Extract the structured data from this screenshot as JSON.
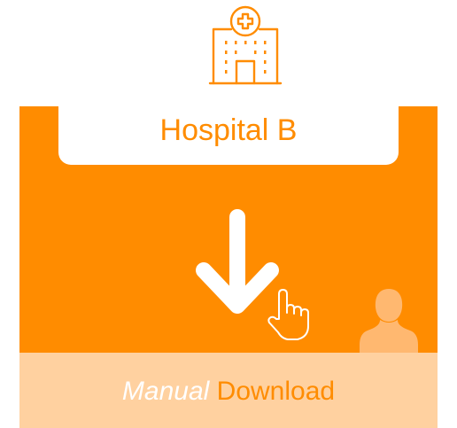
{
  "title": "Hospital B",
  "bottom": {
    "manual": "Manual",
    "download": "Download"
  },
  "colors": {
    "accent": "#FF8C00",
    "band": "#FFD1A0",
    "card": "#FFFFFF",
    "user_silhouette": "#FFB870"
  },
  "icons": {
    "top": "hospital-building-icon",
    "center": "down-arrow-icon",
    "pointer": "hand-pointer-icon",
    "corner": "user-silhouette-icon"
  }
}
